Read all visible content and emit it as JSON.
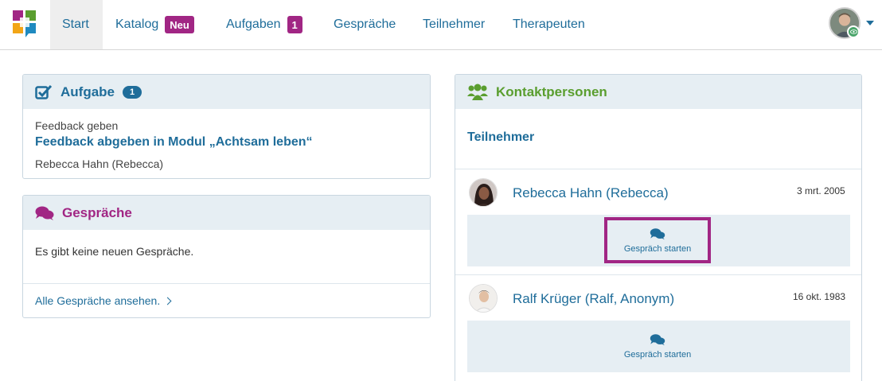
{
  "nav": {
    "items": [
      {
        "label": "Start"
      },
      {
        "label": "Katalog",
        "badge": "Neu"
      },
      {
        "label": "Aufgaben",
        "badge": "1"
      },
      {
        "label": "Gespräche"
      },
      {
        "label": "Teilnehmer"
      },
      {
        "label": "Therapeuten"
      }
    ]
  },
  "task_panel": {
    "title": "Aufgabe",
    "count": "1",
    "type": "Feedback geben",
    "link": "Feedback abgeben in Modul „Achtsam leben“",
    "person": "Rebecca Hahn (Rebecca)"
  },
  "conv_panel": {
    "title": "Gespräche",
    "empty": "Es gibt keine neuen Gespräche.",
    "all_link": "Alle Gespräche ansehen."
  },
  "contacts_panel": {
    "title": "Kontaktpersonen",
    "section": "Teilnehmer",
    "contacts": [
      {
        "name": "Rebecca Hahn (Rebecca)",
        "date": "3 mrt. 2005",
        "action": "Gespräch starten"
      },
      {
        "name": "Ralf Krüger (Ralf, Anonym)",
        "date": "16 okt. 1983",
        "action": "Gespräch starten"
      }
    ]
  },
  "colors": {
    "primary": "#1f6d9a",
    "accent_purple": "#a12684",
    "contacts_green": "#5a9e2f",
    "panel_header": "#e6eef3"
  },
  "icons": [
    "app-logo-icon",
    "checkbox-icon",
    "chat-bubbles-icon",
    "users-icon",
    "eye-icon",
    "caret-down-icon",
    "chevron-right-icon"
  ]
}
